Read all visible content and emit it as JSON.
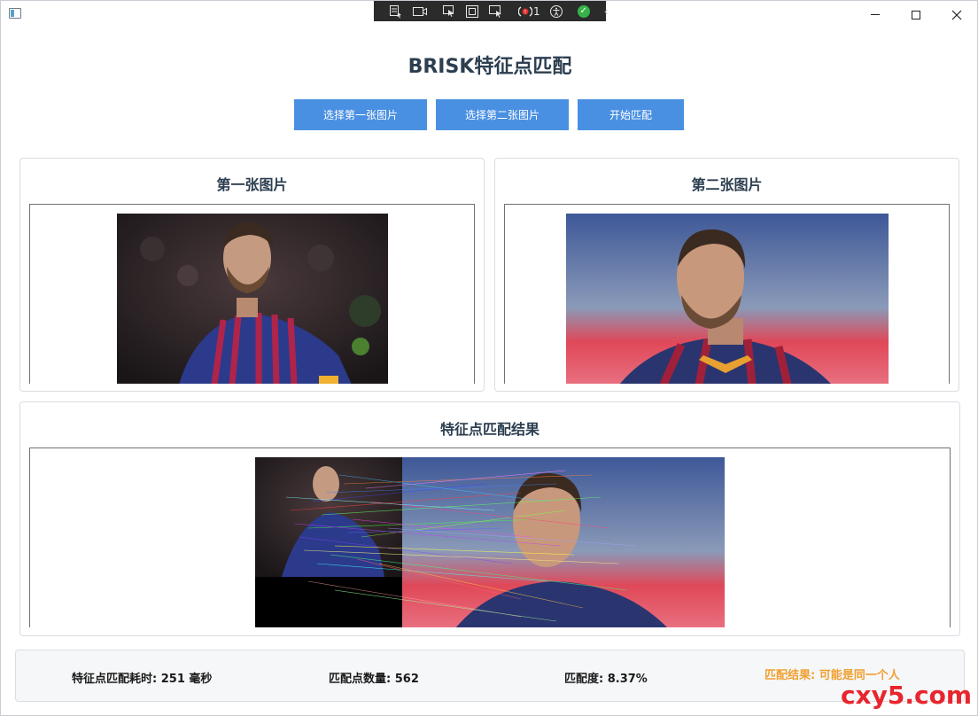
{
  "window": {
    "debug_counter": "1"
  },
  "header": {
    "title": "BRISK特征点匹配"
  },
  "toolbar": {
    "select_first_label": "选择第一张图片",
    "select_second_label": "选择第二张图片",
    "start_match_label": "开始匹配",
    "button_color": "#4a90e2"
  },
  "panels": {
    "first_title": "第一张图片",
    "second_title": "第二张图片",
    "result_title": "特征点匹配结果"
  },
  "status": {
    "time_label": "特征点匹配耗时: 251 毫秒",
    "count_label": "匹配点数量: 562",
    "ratio_label": "匹配度: 8.37%",
    "result_label": "匹配结果: 可能是同一个人",
    "result_color": "#f0a030"
  },
  "watermark": {
    "text": "cxy5.com"
  },
  "icons": {
    "app": "app-window-icon",
    "debug": [
      "select-element-icon",
      "video-icon",
      "pointer-icon",
      "frame-icon",
      "hot-reload-icon",
      "binding-failures-icon",
      "accessibility-icon",
      "check-icon",
      "chevron-left-icon"
    ],
    "window": [
      "minimize-icon",
      "maximize-icon",
      "close-icon"
    ]
  }
}
